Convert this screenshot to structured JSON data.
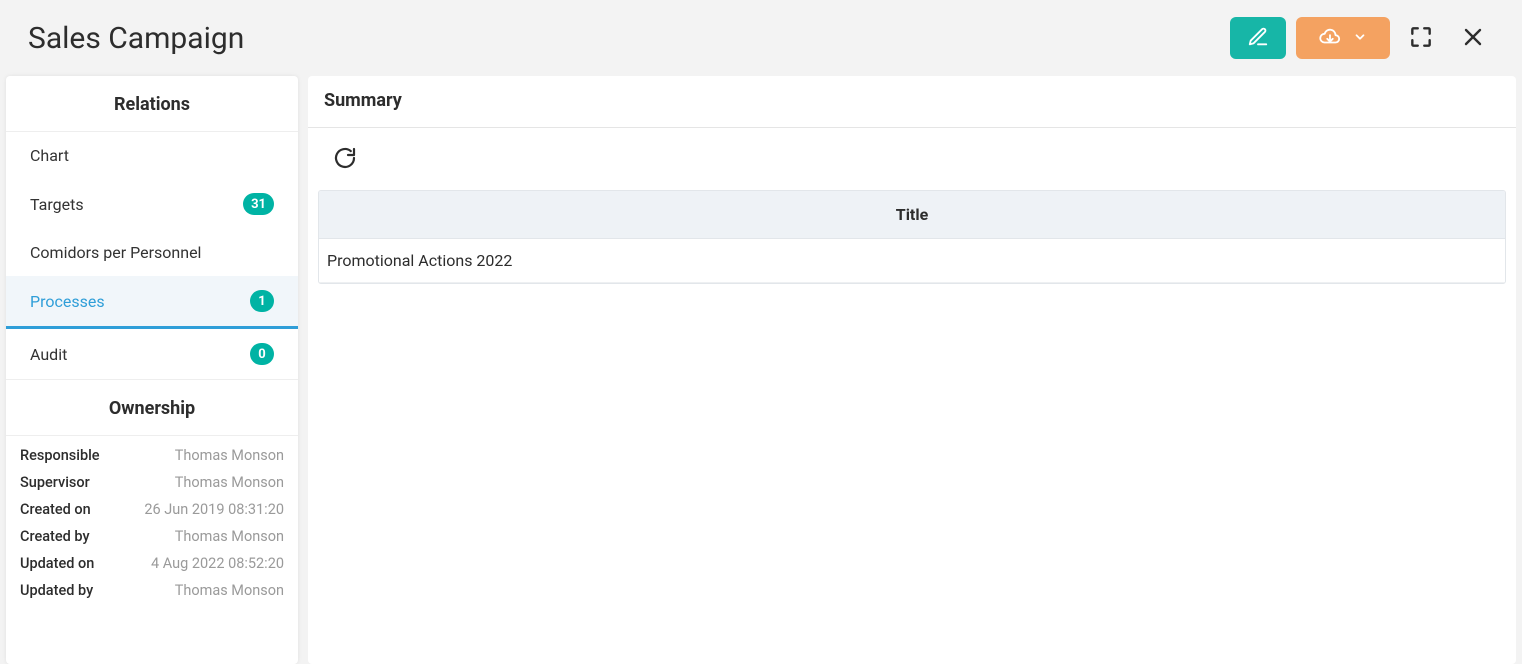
{
  "header": {
    "title": "Sales Campaign"
  },
  "sidebar": {
    "relations_header": "Relations",
    "items": [
      {
        "label": "Chart",
        "badge": null,
        "active": false
      },
      {
        "label": "Targets",
        "badge": "31",
        "active": false
      },
      {
        "label": "Comidors per Personnel",
        "badge": null,
        "active": false
      },
      {
        "label": "Processes",
        "badge": "1",
        "active": true
      },
      {
        "label": "Audit",
        "badge": "0",
        "active": false
      }
    ],
    "ownership_header": "Ownership",
    "ownership": [
      {
        "label": "Responsible",
        "value": "Thomas Monson"
      },
      {
        "label": "Supervisor",
        "value": "Thomas Monson"
      },
      {
        "label": "Created on",
        "value": "26 Jun 2019 08:31:20"
      },
      {
        "label": "Created by",
        "value": "Thomas Monson"
      },
      {
        "label": "Updated on",
        "value": "4 Aug 2022 08:52:20"
      },
      {
        "label": "Updated by",
        "value": "Thomas Monson"
      }
    ]
  },
  "main": {
    "summary_label": "Summary",
    "table": {
      "column_header": "Title",
      "rows": [
        {
          "title": "Promotional Actions 2022"
        }
      ]
    }
  }
}
